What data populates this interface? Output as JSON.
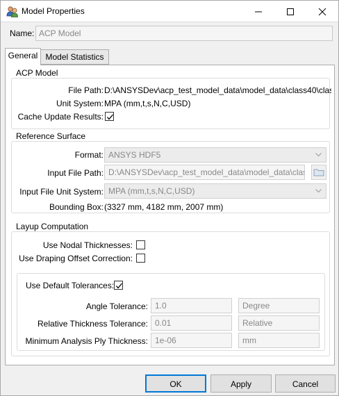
{
  "window": {
    "title": "Model Properties",
    "icon": "people-icon",
    "controls": [
      "minimize-icon",
      "maximize-icon",
      "close-icon"
    ]
  },
  "name": {
    "label": "Name:",
    "value": "ACP Model"
  },
  "tabs": [
    {
      "label": "General",
      "selected": true
    },
    {
      "label": "Model Statistics",
      "selected": false
    }
  ],
  "acp_model": {
    "title": "ACP Model",
    "file_path_label": "File Path:",
    "file_path_value": "D:\\ANSYSDev\\acp_test_model_data\\model_data\\class40\\clas ←",
    "unit_system_label": "Unit System:",
    "unit_system_value": "MPA (mm,t,s,N,C,USD)",
    "cache_label": "Cache Update Results:",
    "cache_checked": true
  },
  "reference_surface": {
    "title": "Reference Surface",
    "format_label": "Format:",
    "format_value": "ANSYS HDF5",
    "input_path_label": "Input File Path:",
    "input_path_value": "D:\\ANSYSDev\\acp_test_model_data\\model_data\\class",
    "unit_label": "Input File Unit System:",
    "unit_value": "MPA (mm,t,s,N,C,USD)",
    "bbox_label": "Bounding Box:",
    "bbox_value": "(3327 mm, 4182 mm, 2007 mm)"
  },
  "layup": {
    "title": "Layup Computation",
    "nodal_label": "Use Nodal Thicknesses:",
    "nodal_checked": false,
    "draping_label": "Use Draping Offset Correction:",
    "draping_checked": false,
    "default_tol_label": "Use Default Tolerances:",
    "default_tol_checked": true,
    "angle_label": "Angle Tolerance:",
    "angle_value": "1.0",
    "angle_unit": "Degree",
    "rel_label": "Relative Thickness Tolerance:",
    "rel_value": "0.01",
    "rel_unit": "Relative",
    "min_label": "Minimum Analysis Ply Thickness:",
    "min_value": "1e-06",
    "min_unit": "mm"
  },
  "buttons": {
    "ok": "OK",
    "apply": "Apply",
    "cancel": "Cancel"
  },
  "colors": {
    "focus_blue": "#0078d7",
    "window_bg": "#f0f0f0"
  }
}
